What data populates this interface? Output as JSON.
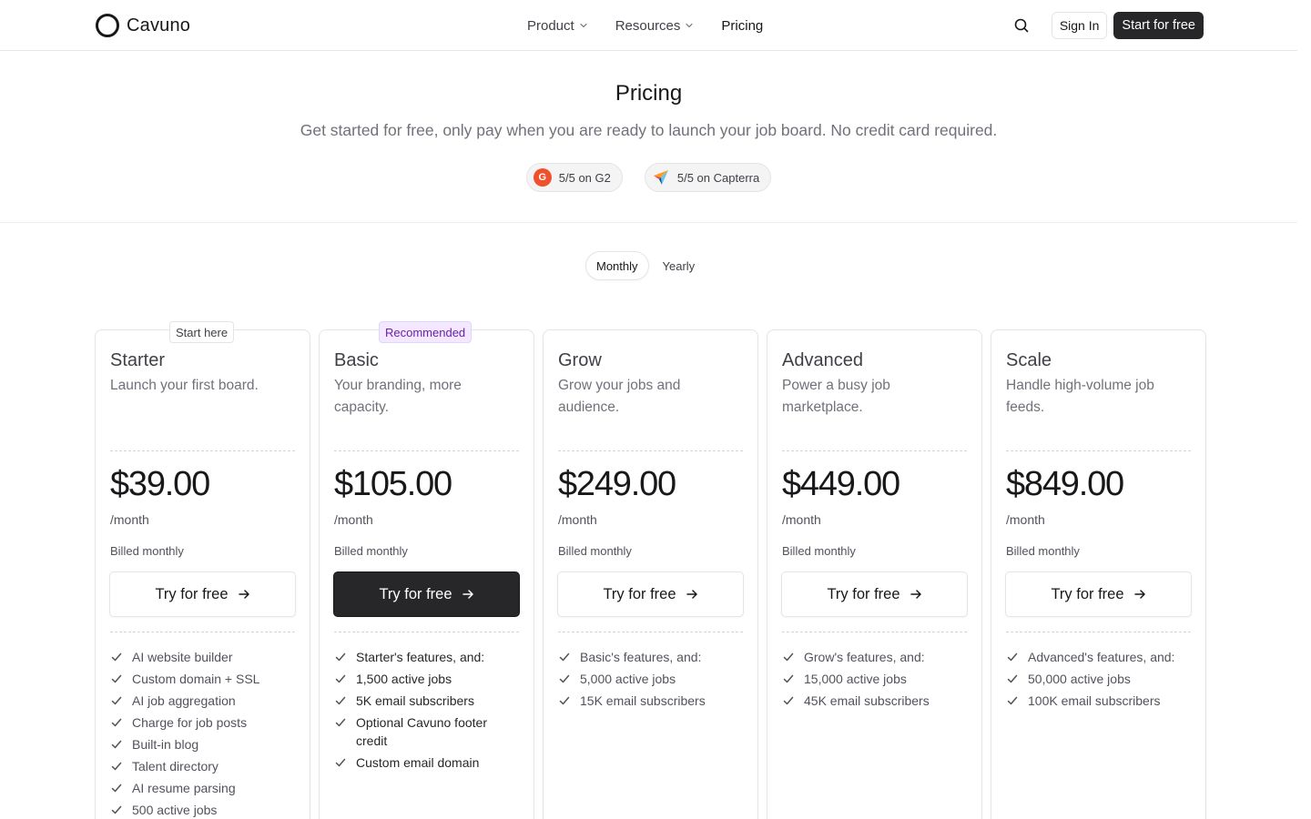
{
  "nav": {
    "brand": "Cavuno",
    "menu": [
      {
        "label": "Product",
        "has_dropdown": true
      },
      {
        "label": "Resources",
        "has_dropdown": true
      },
      {
        "label": "Pricing",
        "has_dropdown": false
      }
    ],
    "signin_label": "Sign In",
    "start_label": "Start for free"
  },
  "hero": {
    "title": "Pricing",
    "subtitle": "Get started for free, only pay when you are ready to launch your job board. No credit card required.",
    "badges": [
      {
        "icon": "g2-icon",
        "label": "5/5 on G2"
      },
      {
        "icon": "capterra-icon",
        "label": "5/5 on Capterra"
      }
    ]
  },
  "billing_toggle": {
    "options": [
      "Monthly",
      "Yearly"
    ],
    "selected": "Monthly"
  },
  "plans": [
    {
      "tag": "Start here",
      "name": "Starter",
      "description": "Launch your first board.",
      "price": "$39.00",
      "period": "/month",
      "billed": "Billed monthly",
      "cta": "Try for free",
      "features": [
        "AI website builder",
        "Custom domain + SSL",
        "AI job aggregation",
        "Charge for job posts",
        "Built-in blog",
        "Talent directory",
        "AI resume parsing",
        "500 active jobs"
      ]
    },
    {
      "tag": "Recommended",
      "name": "Basic",
      "description": "Your branding, more capacity.",
      "price": "$105.00",
      "period": "/month",
      "billed": "Billed monthly",
      "cta": "Try for free",
      "features": [
        "Starter's features, and:",
        "1,500 active jobs",
        "5K email subscribers",
        "Optional Cavuno footer credit",
        "Custom email domain"
      ]
    },
    {
      "tag": "",
      "name": "Grow",
      "description": "Grow your jobs and audience.",
      "price": "$249.00",
      "period": "/month",
      "billed": "Billed monthly",
      "cta": "Try for free",
      "features": [
        "Basic's features, and:",
        "5,000 active jobs",
        "15K email subscribers"
      ]
    },
    {
      "tag": "",
      "name": "Advanced",
      "description": "Power a busy job marketplace.",
      "price": "$449.00",
      "period": "/month",
      "billed": "Billed monthly",
      "cta": "Try for free",
      "features": [
        "Grow's features, and:",
        "15,000 active jobs",
        "45K email subscribers"
      ]
    },
    {
      "tag": "",
      "name": "Scale",
      "description": "Handle high-volume job feeds.",
      "price": "$849.00",
      "period": "/month",
      "billed": "Billed monthly",
      "cta": "Try for free",
      "features": [
        "Advanced's features, and:",
        "50,000 active jobs",
        "100K email subscribers"
      ]
    }
  ],
  "colors": {
    "text_primary": "#18181b",
    "text_muted": "#71717a",
    "border": "#e4e4e7",
    "dark_button": "#27272a",
    "recommended_bg": "#f3e8ff",
    "recommended_text": "#6b21a8",
    "g2_brand": "#f0512d"
  }
}
